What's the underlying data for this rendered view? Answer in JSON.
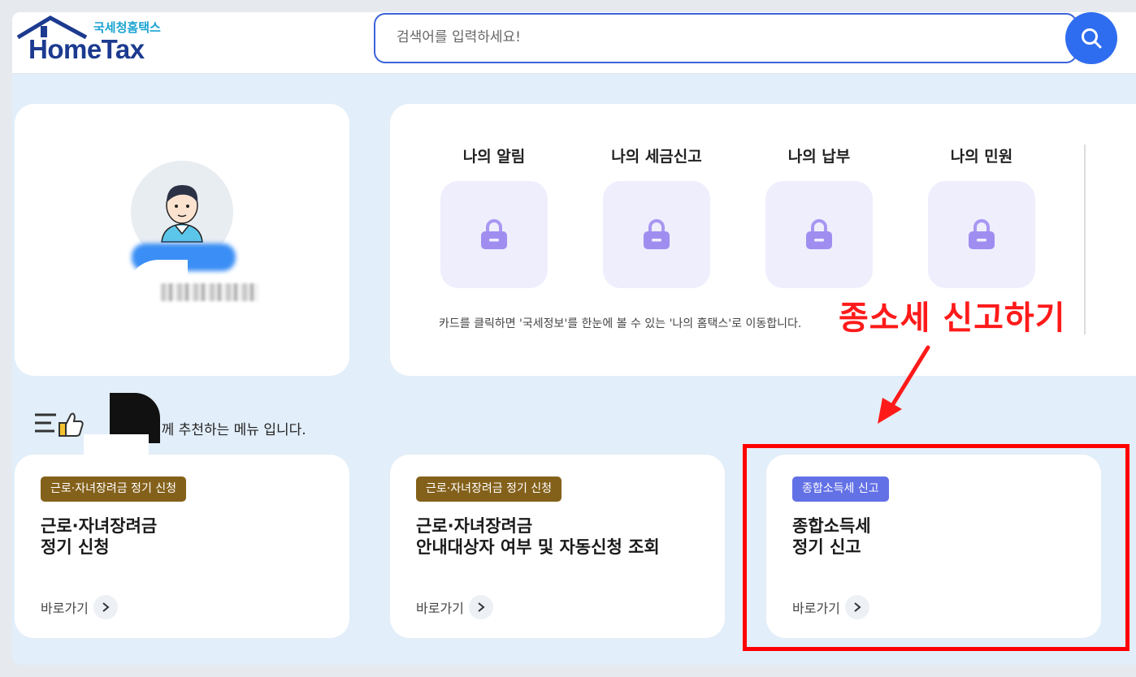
{
  "header": {
    "logo_sub": "국세청홈택스",
    "logo_main": "HomeTax",
    "search_placeholder": "검색어를 입력하세요!",
    "search_icon": "search-icon"
  },
  "mytax": {
    "items": [
      {
        "label": "나의 알림",
        "icon": "lock-icon"
      },
      {
        "label": "나의 세금신고",
        "icon": "lock-icon"
      },
      {
        "label": "나의 납부",
        "icon": "lock-icon"
      },
      {
        "label": "나의 민원",
        "icon": "lock-icon"
      }
    ],
    "note": "카드를 클릭하면 '국세정보'를 한눈에 볼 수 있는 '나의 홈택스'로 이동합니다."
  },
  "recommend": {
    "text": "님께 추천하는 메뉴 입니다.",
    "icon": "thumbs-up-list-icon"
  },
  "menu_cards": [
    {
      "badge": "근로·자녀장려금 정기 신청",
      "title_line1": "근로·자녀장려금",
      "title_line2": "정기 신청",
      "go": "바로가기",
      "badge_color": "#84611b"
    },
    {
      "badge": "근로·자녀장려금 정기 신청",
      "title_line1": "근로·자녀장려금",
      "title_line2": "안내대상자 여부 및 자동신청 조회",
      "go": "바로가기",
      "badge_color": "#84611b"
    },
    {
      "badge": "종합소득세 신고",
      "title_line1": "종합소득세",
      "title_line2": "정기 신고",
      "go": "바로가기",
      "badge_color": "#6371e6"
    }
  ],
  "annotation": {
    "text": "종소세 신고하기",
    "color": "#ff1a1a"
  }
}
